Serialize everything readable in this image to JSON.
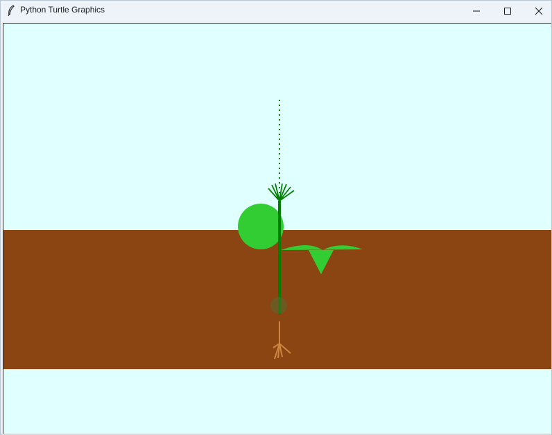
{
  "window": {
    "title": "Python Turtle Graphics",
    "controls": {
      "minimize_icon": "minimize-icon",
      "maximize_icon": "maximize-icon",
      "close_icon": "close-icon"
    }
  },
  "scene": {
    "colors": {
      "sky": "#e0ffff",
      "soil": "#8b4513",
      "leaf": "#32cd32",
      "stem": "#008000",
      "root": "#cd853f",
      "seed": "#556b2f"
    }
  }
}
